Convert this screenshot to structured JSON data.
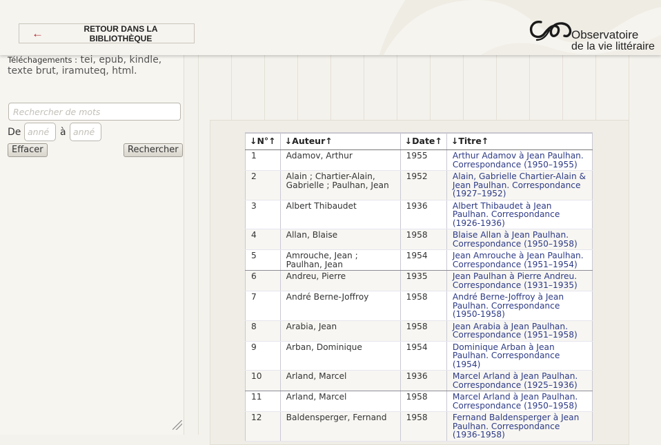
{
  "header": {
    "back_label": "RETOUR DANS LA BIBLIOTHÈQUE",
    "logo_line1": "Observatoire",
    "logo_line2": "de la vie littéraire"
  },
  "sidebar": {
    "downloads_label": "Téléchagements :",
    "downloads_formats": " tei, epub, kindle, texte brut, iramuteq, html.",
    "search_placeholder": "Rechercher de mots",
    "from_label": "De",
    "to_label": "à",
    "from_placeholder": "anné",
    "to_placeholder": "anné",
    "clear_button": "Effacer",
    "search_button": "Rechercher"
  },
  "table": {
    "headers": [
      "↓N°↑",
      "↓Auteur↑",
      "↓Date↑",
      "↓Titre↑"
    ],
    "rows": [
      {
        "n": "1",
        "author": "Adamov, Arthur",
        "date": "1955",
        "title": "Arthur Adamov à Jean Paulhan. Correspondance (1950–1955)"
      },
      {
        "n": "2",
        "author": "Alain ; Chartier-Alain, Gabrielle ; Paulhan, Jean",
        "date": "1952",
        "title": "Alain, Gabrielle Chartier-Alain & Jean Paulhan. Correspondance (1927–1952)"
      },
      {
        "n": "3",
        "author": "Albert Thibaudet",
        "date": "1936",
        "title": "Albert Thibaudet à Jean Paulhan. Correspondance (1926-1936)"
      },
      {
        "n": "4",
        "author": "Allan, Blaise",
        "date": "1958",
        "title": "Blaise Allan à Jean Paulhan. Correspondance (1950–1958)"
      },
      {
        "n": "5",
        "author": "Amrouche, Jean ; Paulhan, Jean",
        "date": "1954",
        "title": "Jean Amrouche à Jean Paulhan. Correspondance (1951–1954)"
      },
      {
        "n": "6",
        "author": "Andreu, Pierre",
        "date": "1935",
        "title": "Jean Paulhan à Pierre Andreu. Correspondance (1931–1935)"
      },
      {
        "n": "7",
        "author": "André Berne-Joffroy",
        "date": "1958",
        "title": "André Berne-Joffroy à Jean Paulhan. Correspondance (1950-1958)"
      },
      {
        "n": "8",
        "author": "Arabia, Jean",
        "date": "1958",
        "title": "Jean Arabia à Jean Paulhan. Correspondance (1951–1958)"
      },
      {
        "n": "9",
        "author": "Arban, Dominique",
        "date": "1954",
        "title": "Dominique Arban à Jean Paulhan. Correspondance (1954)"
      },
      {
        "n": "10",
        "author": "Arland, Marcel",
        "date": "1936",
        "title": "Marcel Arland à Jean Paulhan. Correspondance (1925–1936)"
      },
      {
        "n": "11",
        "author": "Arland, Marcel",
        "date": "1958",
        "title": "Marcel Arland à Jean Paulhan. Correspondance (1950–1958)"
      },
      {
        "n": "12",
        "author": "Baldensperger, Fernand",
        "date": "1958",
        "title": "Fernand Baldensperger à Jean Paulhan. Correspondance (1936-1958)"
      }
    ]
  },
  "colors": {
    "accent_red": "#b3262c",
    "link_blue": "#2d3a86",
    "background": "#f4f2ec"
  }
}
